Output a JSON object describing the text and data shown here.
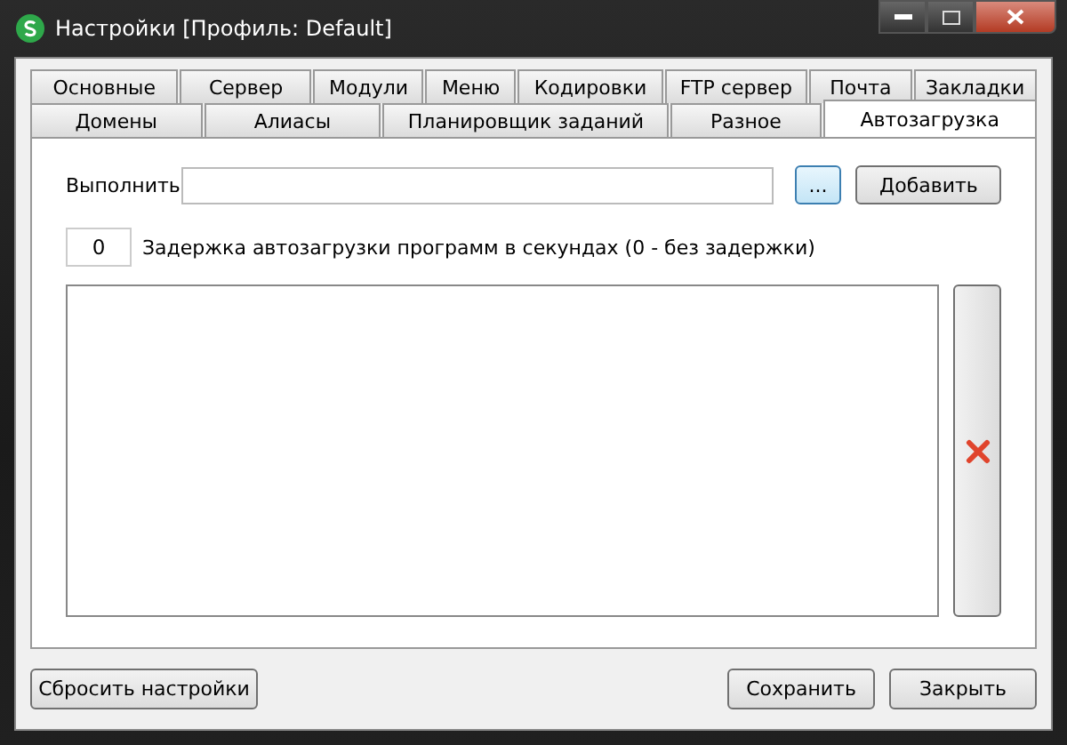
{
  "window": {
    "title": "Настройки [Профиль: Default]"
  },
  "tab_rows": [
    [
      {
        "label": "Основные",
        "selected": false
      },
      {
        "label": "Сервер",
        "selected": false
      },
      {
        "label": "Модули",
        "selected": false
      },
      {
        "label": "Меню",
        "selected": false
      },
      {
        "label": "Кодировки",
        "selected": false
      },
      {
        "label": "FTP сервер",
        "selected": false
      },
      {
        "label": "Почта",
        "selected": false
      },
      {
        "label": "Закладки",
        "selected": false
      }
    ],
    [
      {
        "label": "Домены",
        "selected": false
      },
      {
        "label": "Алиасы",
        "selected": false
      },
      {
        "label": "Планировщик заданий",
        "selected": false
      },
      {
        "label": "Разное",
        "selected": false
      },
      {
        "label": "Автозагрузка",
        "selected": true
      }
    ]
  ],
  "run": {
    "label": "Выполнить",
    "browse_button": "...",
    "add_button": "Добавить"
  },
  "delay": {
    "value": "0",
    "label": "Задержка автозагрузки программ в секундах (0 - без задержки)"
  },
  "buttons": {
    "reset": "Сбросить настройки",
    "save": "Сохранить",
    "close": "Закрыть"
  }
}
